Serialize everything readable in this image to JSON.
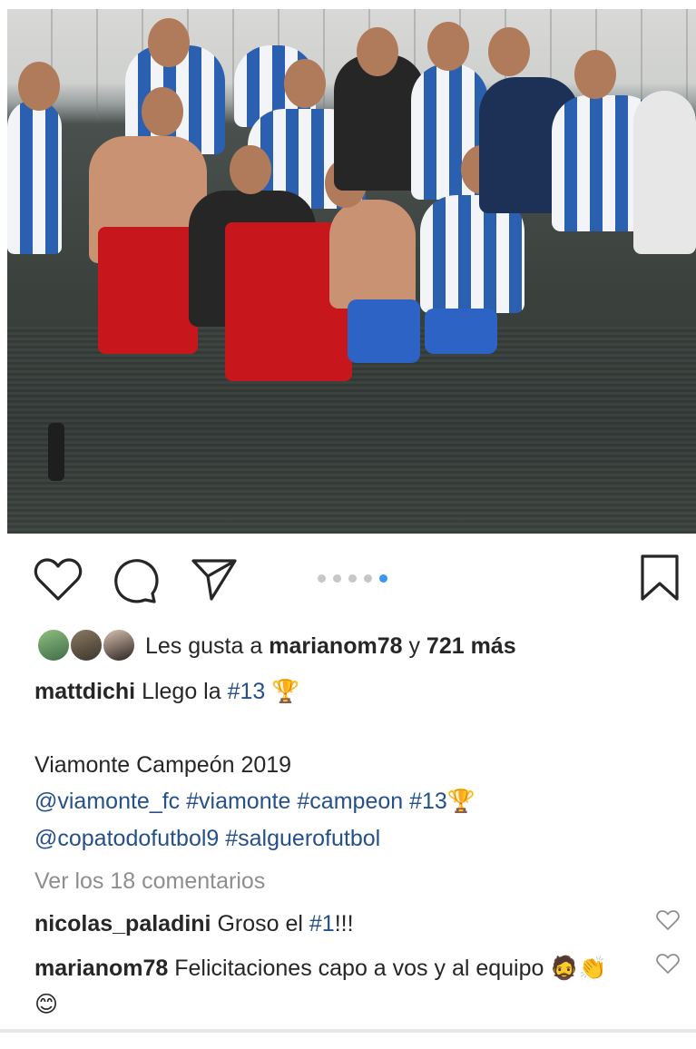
{
  "post": {
    "image_alt": "photo",
    "carousel": {
      "count": 5,
      "active_index": 4
    }
  },
  "likes": {
    "prefix": "Les gusta a ",
    "user": "marianom78",
    "middle": " y ",
    "count": "721 más"
  },
  "caption": {
    "author": "mattdichi",
    "line1_text": " Llego la ",
    "line1_tag": "#13",
    "line1_emoji": "🏆",
    "line2": "Viamonte Campeón 2019",
    "line3_tags": "@viamonte_fc #viamonte #campeon #13",
    "line3_emoji": "🏆",
    "line4_tags": "@copatodofutbol9 #salguerofutbol"
  },
  "view_comments": "Ver los 18 comentarios",
  "comments": [
    {
      "user": "nicolas_paladini",
      "text": " Groso el ",
      "tag": "#1",
      "after": "!!!"
    },
    {
      "user": "marianom78",
      "text": " Felicitaciones capo a vos y al equipo ",
      "emojis": "🧔👏😊"
    }
  ],
  "colors": {
    "hashtag": "#26508a",
    "muted": "#8e8e8e",
    "active_dot": "#3897f0"
  }
}
